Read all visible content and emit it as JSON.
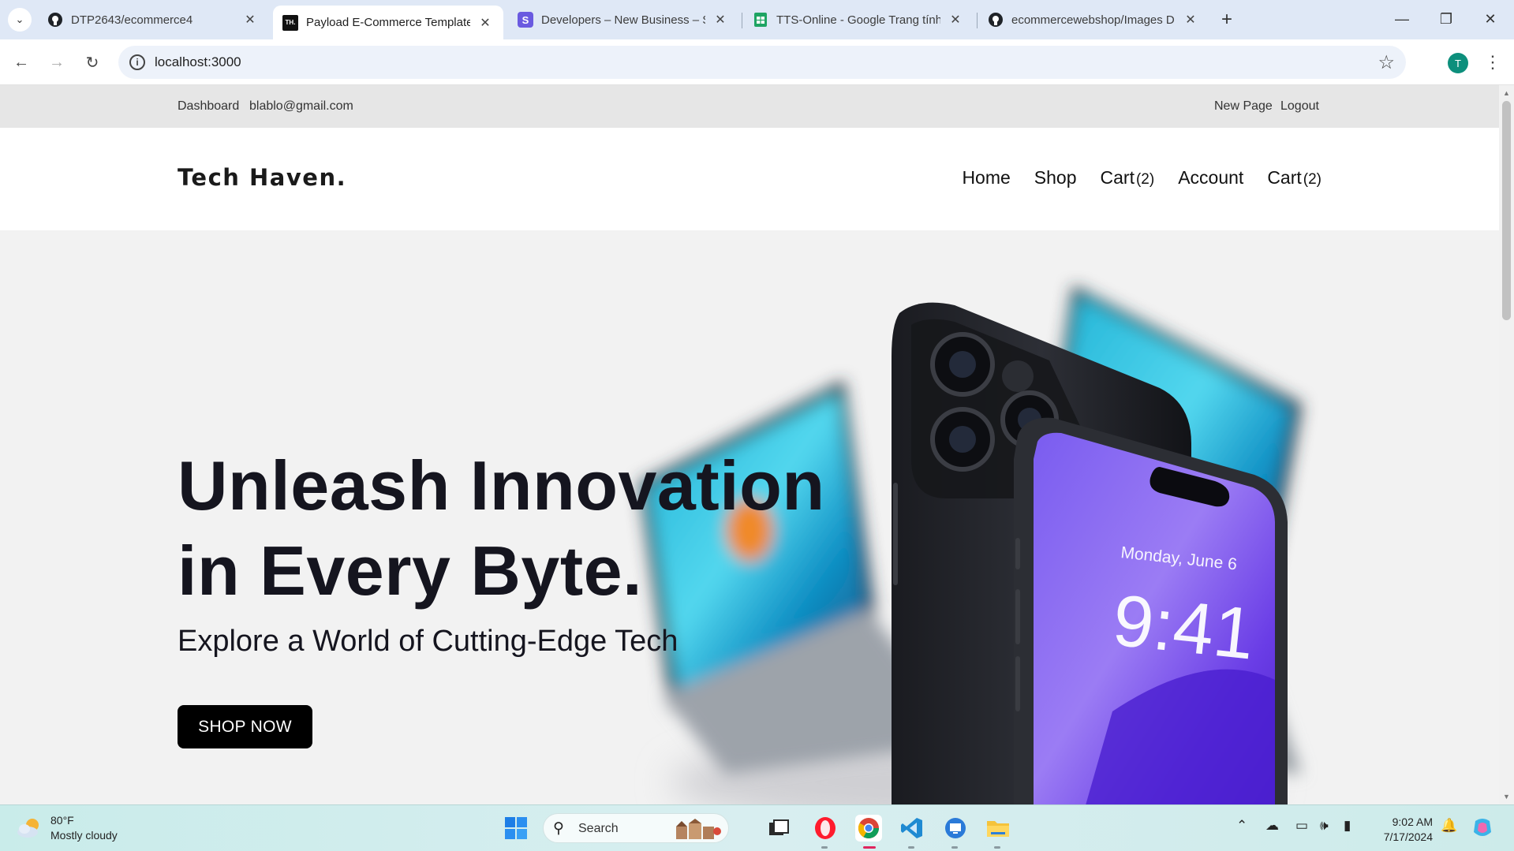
{
  "browser": {
    "tabs": [
      {
        "title": "DTP2643/ecommerce4",
        "favicon": "github-icon",
        "active": false
      },
      {
        "title": "Payload E-Commerce Template",
        "favicon": "TH.",
        "active": true
      },
      {
        "title": "Developers – New Business – St",
        "favicon": "S",
        "active": false
      },
      {
        "title": "TTS-Online - Google Trang tính",
        "favicon": "sheets-icon",
        "active": false
      },
      {
        "title": "ecommercewebshop/Images D",
        "favicon": "github-icon",
        "active": false
      }
    ],
    "url": "localhost:3000",
    "profile_initial": "T"
  },
  "admin_bar": {
    "dashboard": "Dashboard",
    "email": "blablo@gmail.com",
    "new_page": "New Page",
    "logout": "Logout"
  },
  "header": {
    "logo": "Tech Haven.",
    "nav": {
      "home": "Home",
      "shop": "Shop",
      "cart": "Cart",
      "cart_count": "(2)",
      "account": "Account",
      "cart2": "Cart",
      "cart2_count": "(2)"
    }
  },
  "hero": {
    "title_line1": "Unleash Innovation",
    "title_line2": "in Every Byte.",
    "subtitle": "Explore a World of Cutting-Edge Tech",
    "cta": "SHOP NOW",
    "phone_date": "Monday, June 6",
    "phone_time": "9:41"
  },
  "taskbar": {
    "temperature": "80°F",
    "condition": "Mostly cloudy",
    "search": "Search",
    "time": "9:02 AM",
    "date": "7/17/2024"
  }
}
